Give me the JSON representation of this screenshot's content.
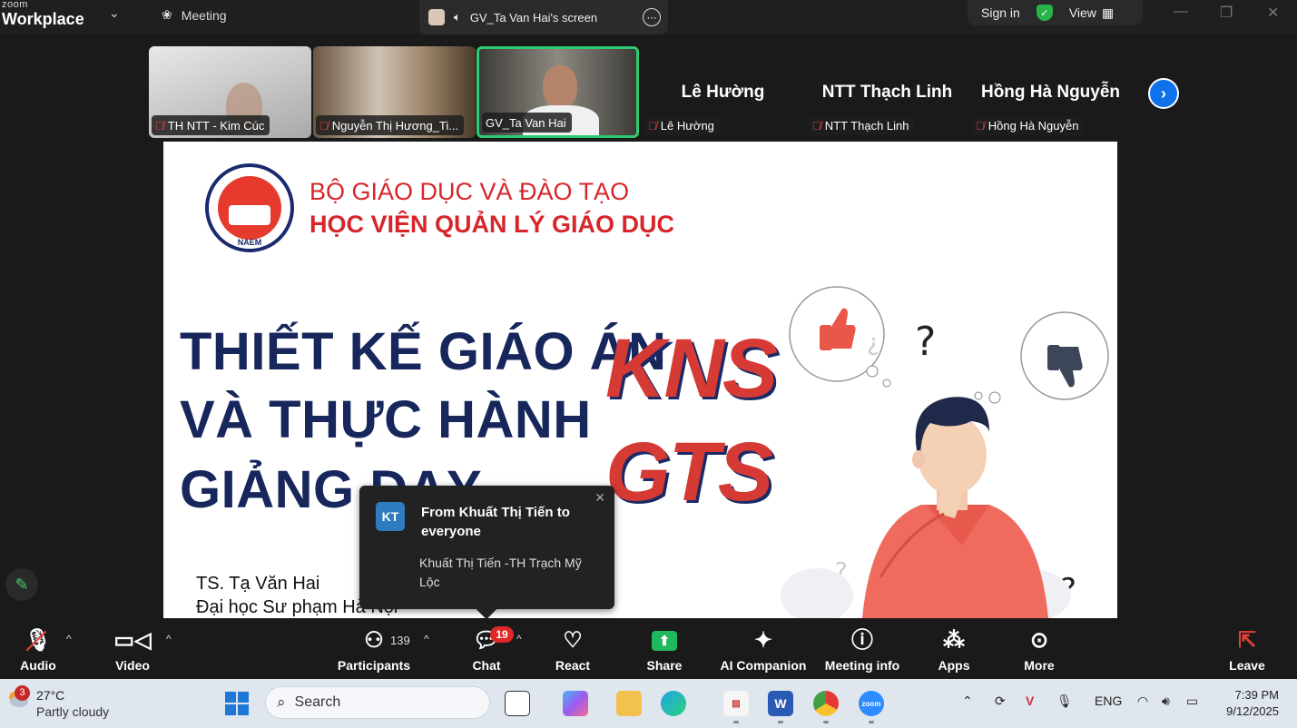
{
  "app": {
    "brand_top": "zoom",
    "brand_name": "Workplace",
    "meeting_label": "Meeting",
    "screen_title": "GV_Ta Van Hai's screen",
    "sign_in": "Sign in",
    "view": "View"
  },
  "participants": [
    {
      "name": "TH NTT - Kim Cúc",
      "type": "video"
    },
    {
      "name": "Nguyễn Thị Hương_Ti...",
      "type": "video"
    },
    {
      "name": "GV_Ta Van Hai",
      "type": "video",
      "active": true
    },
    {
      "name": "Lê Hường",
      "display": "Lê Hường",
      "type": "name"
    },
    {
      "name": "NTT Thạch Linh",
      "display": "NTT Thạch Linh",
      "type": "name"
    },
    {
      "name": "Hồng Hà Nguyễn",
      "display": "Hồng Hà Nguyễn",
      "type": "name"
    }
  ],
  "slide": {
    "org_line1": "BỘ GIÁO DỤC VÀ ĐÀO TẠO",
    "org_line2": "HỌC VIỆN QUẢN LÝ GIÁO DỤC",
    "logo_text": "NAEM",
    "title_line1": "THIẾT KẾ GIÁO ÁN",
    "title_line2": "VÀ THỰC HÀNH",
    "title_line3": "GIẢNG DẠY",
    "badge1": "KNS",
    "badge2": "GTS",
    "author": "TS. Tạ Văn Hai",
    "school": "Đại học Sư phạm Hà Nội"
  },
  "chat_popup": {
    "avatar": "KT",
    "title": "From Khuất Thị Tiến to everyone",
    "message": "Khuất Thị Tiến -TH Trạch Mỹ Lộc"
  },
  "toolbar": {
    "audio": "Audio",
    "video": "Video",
    "participants": "Participants",
    "participant_count": "139",
    "chat": "Chat",
    "chat_badge": "19",
    "react": "React",
    "share": "Share",
    "ai": "AI Companion",
    "info": "Meeting info",
    "apps": "Apps",
    "more": "More",
    "leave": "Leave"
  },
  "taskbar": {
    "weather_badge": "3",
    "temp": "27°C",
    "condition": "Partly cloudy",
    "search": "Search",
    "lang": "ENG",
    "time": "7:39 PM",
    "date": "9/12/2025"
  },
  "colors": {
    "active_border": "#2ecc71",
    "slide_red": "#d6262b",
    "slide_navy": "#17275c",
    "share_green": "#1fb85c",
    "badge_red": "#e02828"
  }
}
